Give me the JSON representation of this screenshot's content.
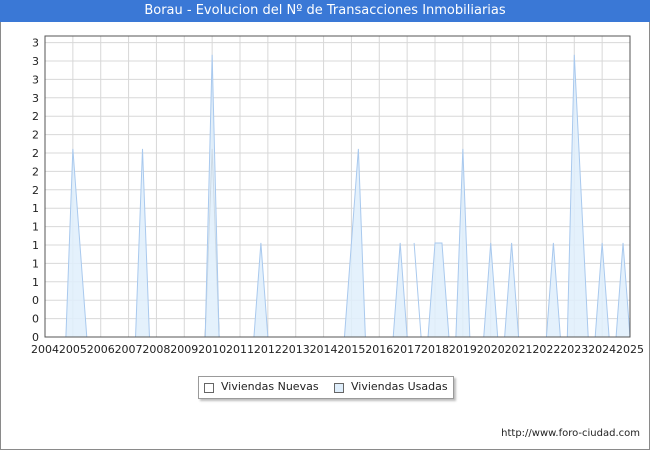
{
  "chart_data": {
    "type": "area",
    "title": "Borau - Evolucion del Nº de Transacciones Inmobiliarias",
    "x_ticks": [
      "2004",
      "2005",
      "2006",
      "2007",
      "2008",
      "2009",
      "2010",
      "2011",
      "2012",
      "2013",
      "2014",
      "2015",
      "2016",
      "2017",
      "2018",
      "2019",
      "2020",
      "2021",
      "2022",
      "2023",
      "2024",
      "2025"
    ],
    "y_ticks": [
      "0",
      "0",
      "0",
      "1",
      "1",
      "1",
      "1",
      "1",
      "2",
      "2",
      "2",
      "2",
      "2",
      "3",
      "3",
      "3",
      "3"
    ],
    "ylim": [
      0,
      3.2
    ],
    "grid": true,
    "legend_position": "bottom-center",
    "series": [
      {
        "name": "Viviendas Nuevas",
        "fill": "#ffffff",
        "stroke": "#666666",
        "points": [
          [
            2009.75,
            0
          ],
          [
            2010.0,
            2
          ],
          [
            2010.25,
            0
          ]
        ]
      },
      {
        "name": "Viviendas Usadas",
        "fill": "#dfeefb",
        "stroke": "#a9c9ee",
        "points": [
          [
            2004.75,
            0
          ],
          [
            2005.0,
            2
          ],
          [
            2005.5,
            0
          ],
          [
            2007.25,
            0
          ],
          [
            2007.5,
            2
          ],
          [
            2007.75,
            0
          ],
          [
            2009.75,
            0
          ],
          [
            2010.0,
            3
          ],
          [
            2010.25,
            0
          ],
          [
            2011.5,
            0
          ],
          [
            2011.75,
            1
          ],
          [
            2012.0,
            0
          ],
          [
            2014.75,
            0
          ],
          [
            2015.25,
            2
          ],
          [
            2015.5,
            0
          ],
          [
            2016.5,
            0
          ],
          [
            2016.75,
            1
          ],
          [
            2017.0,
            0
          ],
          [
            2017.25,
            1
          ],
          [
            2017.5,
            0
          ],
          [
            2017.75,
            0
          ],
          [
            2018.0,
            1
          ],
          [
            2018.25,
            1
          ],
          [
            2018.5,
            0
          ],
          [
            2018.75,
            0
          ],
          [
            2019.0,
            2
          ],
          [
            2019.25,
            0
          ],
          [
            2019.75,
            0
          ],
          [
            2020.0,
            1
          ],
          [
            2020.25,
            0
          ],
          [
            2020.5,
            0
          ],
          [
            2020.75,
            1
          ],
          [
            2021.0,
            0
          ],
          [
            2022.0,
            0
          ],
          [
            2022.25,
            1
          ],
          [
            2022.5,
            0
          ],
          [
            2022.75,
            0
          ],
          [
            2023.0,
            3
          ],
          [
            2023.5,
            0
          ],
          [
            2023.75,
            0
          ],
          [
            2024.0,
            1
          ],
          [
            2024.25,
            0
          ],
          [
            2024.5,
            0
          ],
          [
            2024.75,
            1
          ],
          [
            2025.0,
            0
          ]
        ]
      }
    ]
  },
  "footer": {
    "url": "http://www.foro-ciudad.com"
  },
  "colors": {
    "title_bar": "#3a78d6",
    "grid": "#d8d8d8"
  }
}
